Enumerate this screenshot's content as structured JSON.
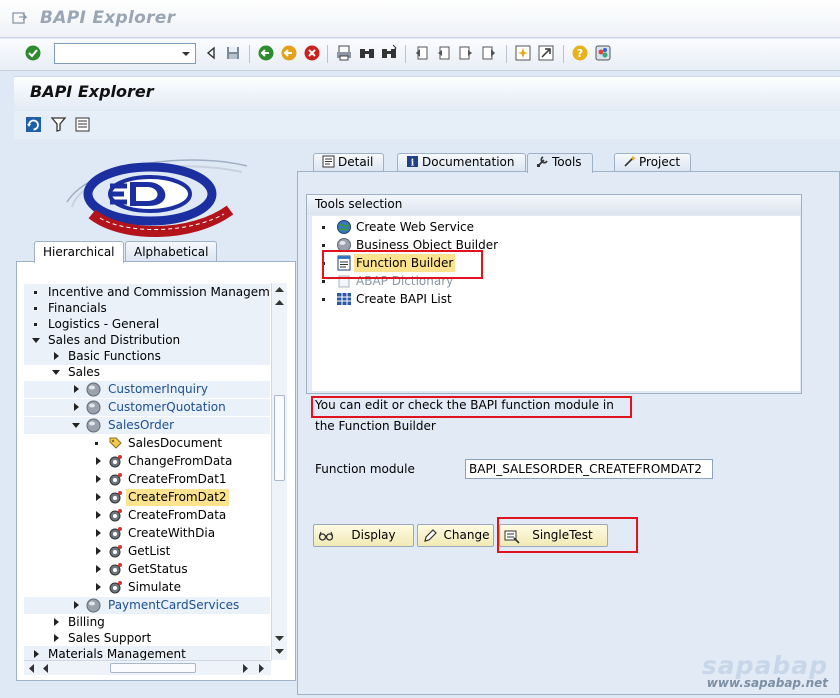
{
  "window": {
    "title": "BAPI Explorer"
  },
  "header": {
    "title": "BAPI Explorer"
  },
  "command_field": {
    "value": ""
  },
  "left_tabs": [
    {
      "label": "Hierarchical",
      "active": true
    },
    {
      "label": "Alphabetical",
      "active": false
    }
  ],
  "tree": [
    {
      "label": "Incentive and Commission Management ("
    },
    {
      "label": "Financials"
    },
    {
      "label": "Logistics - General"
    },
    {
      "label": "Sales and Distribution"
    },
    {
      "label": "Basic Functions"
    },
    {
      "label": "Sales"
    },
    {
      "label": "CustomerInquiry"
    },
    {
      "label": "CustomerQuotation"
    },
    {
      "label": "SalesOrder"
    },
    {
      "label": "SalesDocument"
    },
    {
      "label": "ChangeFromData"
    },
    {
      "label": "CreateFromDat1"
    },
    {
      "label": "CreateFromDat2"
    },
    {
      "label": "CreateFromData"
    },
    {
      "label": "CreateWithDia"
    },
    {
      "label": "GetList"
    },
    {
      "label": "GetStatus"
    },
    {
      "label": "Simulate"
    },
    {
      "label": "PaymentCardServices"
    },
    {
      "label": "Billing"
    },
    {
      "label": "Sales Support"
    },
    {
      "label": "Materials Management"
    }
  ],
  "right_tabs": [
    {
      "label": "Detail",
      "active": false
    },
    {
      "label": "Documentation",
      "active": false
    },
    {
      "label": "Tools",
      "active": true
    },
    {
      "label": "Project",
      "active": false
    }
  ],
  "tools": {
    "title": "Tools selection",
    "items": [
      {
        "label": "Create Web Service"
      },
      {
        "label": "Business Object Builder"
      },
      {
        "label": "Function Builder"
      },
      {
        "label": "ABAP Dictionary"
      },
      {
        "label": "Create BAPI List"
      }
    ]
  },
  "message": {
    "line1": "You can edit or check the BAPI function module in",
    "line2": "the Function Builder"
  },
  "function_module": {
    "label": "Function module",
    "value": "BAPI_SALESORDER_CREATEFROMDAT2"
  },
  "buttons": {
    "display": "Display",
    "change": "Change",
    "single_test": "SingleTest"
  },
  "watermark": {
    "brand": "sapabap",
    "url": "www.sapabap.net"
  },
  "colors": {
    "highlight": "#e0141e",
    "selection": "#fde38e",
    "link": "#1c4f8f"
  }
}
